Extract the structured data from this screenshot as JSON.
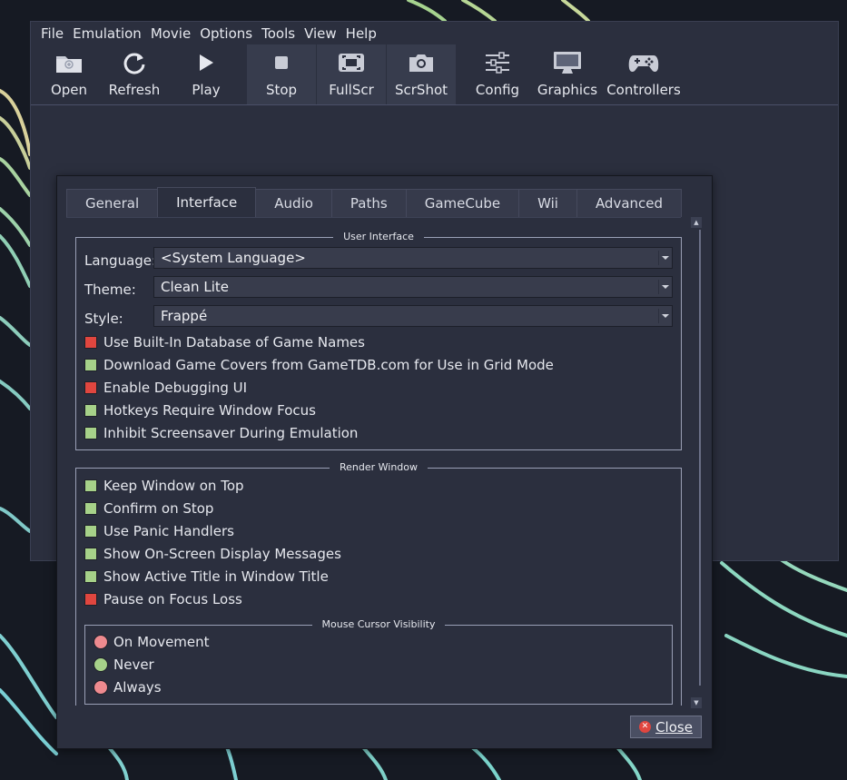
{
  "menubar": {
    "items": [
      {
        "label": "File"
      },
      {
        "label": "Emulation"
      },
      {
        "label": "Movie"
      },
      {
        "label": "Options"
      },
      {
        "label": "Tools"
      },
      {
        "label": "View"
      },
      {
        "label": "Help"
      }
    ]
  },
  "toolbar": {
    "open": "Open",
    "refresh": "Refresh",
    "play": "Play",
    "stop": "Stop",
    "fullscr": "FullScr",
    "scrshot": "ScrShot",
    "config": "Config",
    "graphics": "Graphics",
    "controllers": "Controllers"
  },
  "dialog": {
    "tabs": [
      "General",
      "Interface",
      "Audio",
      "Paths",
      "GameCube",
      "Wii",
      "Advanced"
    ],
    "active_tab": "Interface",
    "user_interface": {
      "title": "User Interface",
      "language_label": "Language:",
      "language_value": "<System Language>",
      "theme_label": "Theme:",
      "theme_value": "Clean Lite",
      "style_label": "Style:",
      "style_value": "Frappé",
      "checkboxes": [
        {
          "label": "Use Built-In Database of Game Names",
          "checked": false
        },
        {
          "label": "Download Game Covers from GameTDB.com for Use in Grid Mode",
          "checked": true
        },
        {
          "label": "Enable Debugging UI",
          "checked": false
        },
        {
          "label": "Hotkeys Require Window Focus",
          "checked": true
        },
        {
          "label": "Inhibit Screensaver During Emulation",
          "checked": true
        }
      ]
    },
    "render_window": {
      "title": "Render Window",
      "checkboxes": [
        {
          "label": "Keep Window on Top",
          "checked": true
        },
        {
          "label": "Confirm on Stop",
          "checked": true
        },
        {
          "label": "Use Panic Handlers",
          "checked": true
        },
        {
          "label": "Show On-Screen Display Messages",
          "checked": true
        },
        {
          "label": "Show Active Title in Window Title",
          "checked": true
        },
        {
          "label": "Pause on Focus Loss",
          "checked": false
        }
      ]
    },
    "cursor": {
      "title": "Mouse Cursor Visibility",
      "options": [
        {
          "label": "On Movement",
          "selected": false
        },
        {
          "label": "Never",
          "selected": true
        },
        {
          "label": "Always",
          "selected": false
        }
      ]
    },
    "close_label": "Close"
  },
  "colors": {
    "checked": "#a6d189",
    "unchecked": "#e0463f",
    "background": "#2b2f3e"
  }
}
